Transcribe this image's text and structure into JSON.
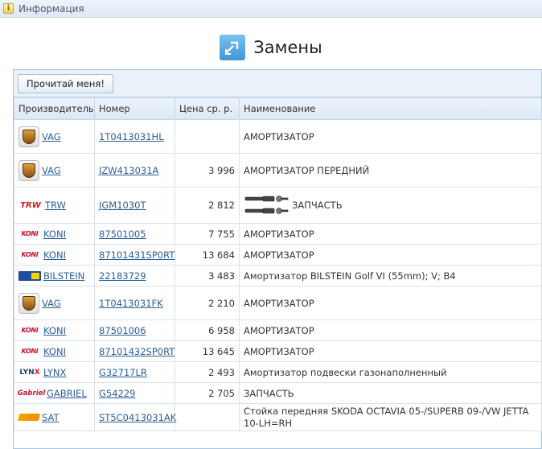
{
  "topbar": {
    "title": "Информация",
    "icon": "info-icon"
  },
  "heading": {
    "title": "Замены",
    "icon": "replace-arrows-icon"
  },
  "toolbar": {
    "readme_label": "Прочитай меня!"
  },
  "table": {
    "headers": [
      "Производитель",
      "Номер",
      "Цена ср. р.",
      "Наименование"
    ],
    "rows": [
      {
        "brand": "VAG",
        "logo": "porsche-crest-icon",
        "number": "1T0413031HL",
        "price": "",
        "name": "АМОРТИЗАТОР"
      },
      {
        "brand": "VAG",
        "logo": "porsche-crest-icon",
        "number": "JZW413031A",
        "price": "3 996",
        "name": "АМОРТИЗАТОР ПЕРЕДНИЙ"
      },
      {
        "brand": "TRW",
        "logo": "trw-logo",
        "number": "JGM1030T",
        "price": "2 812",
        "name": "ЗАПЧАСТЬ",
        "has_image": true
      },
      {
        "brand": "KONI",
        "logo": "koni-logo",
        "number": "87501005",
        "price": "7 755",
        "name": "АМОРТИЗАТОР"
      },
      {
        "brand": "KONI",
        "logo": "koni-logo",
        "number": "87101431SP0RT",
        "price": "13 684",
        "name": "АМОРТИЗАТОР"
      },
      {
        "brand": "BILSTEIN",
        "logo": "bilstein-logo",
        "number": "22183729",
        "price": "3 483",
        "name": "Амортизатор BILSTEIN Golf VI (55mm); V; B4"
      },
      {
        "brand": "VAG",
        "logo": "porsche-crest-icon",
        "number": "1T0413031FK",
        "price": "2 210",
        "name": "АМОРТИЗАТОР"
      },
      {
        "brand": "KONI",
        "logo": "koni-logo",
        "number": "87501006",
        "price": "6 958",
        "name": "АМОРТИЗАТОР"
      },
      {
        "brand": "KONI",
        "logo": "koni-logo",
        "number": "87101432SP0RT",
        "price": "13 645",
        "name": "АМОРТИЗАТОР"
      },
      {
        "brand": "LYNX",
        "logo": "lynx-logo",
        "number": "G32717LR",
        "price": "2 493",
        "name": "Амортизатор подвески газонаполненный"
      },
      {
        "brand": "GABRIEL",
        "logo": "gabriel-logo",
        "number": "G54229",
        "price": "2 705",
        "name": "ЗАПЧАСТЬ"
      },
      {
        "brand": "SAT",
        "logo": "sat-logo",
        "number": "ST5C0413031AK",
        "price": "",
        "name": "Стойка передняя SKODA OCTAVIA 05-/SUPERB 09-/VW JETTA 10-LH=RH"
      }
    ]
  },
  "logo_text": {
    "trw": "TRW",
    "koni": "KONI",
    "lynx_a": "LYN",
    "lynx_b": "X",
    "gabriel": "Gabriel"
  },
  "colors": {
    "accent": "#2a5d9a",
    "header_bg": "#dbe7f4",
    "border": "#a9c6e3"
  }
}
